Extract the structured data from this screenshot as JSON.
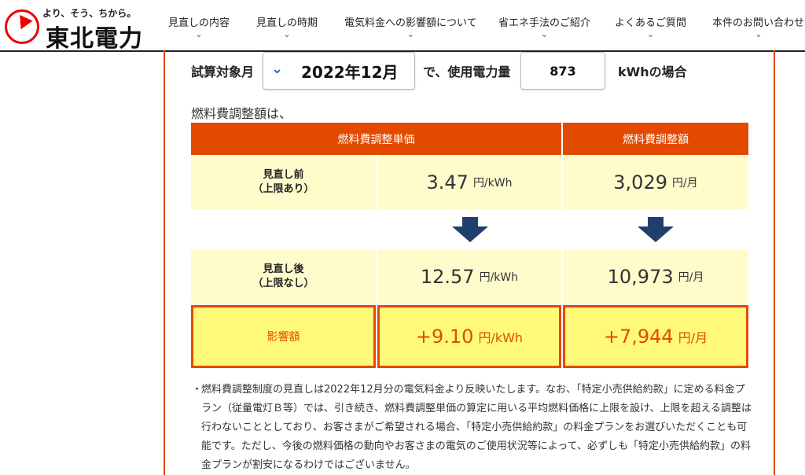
{
  "header": {
    "logo_tagline": "より、そう、ちから。",
    "logo_name": "東北電力",
    "nav": [
      {
        "label": "見直しの内容"
      },
      {
        "label": "見直しの時期"
      },
      {
        "label": "電気料金への影響額について"
      },
      {
        "label": "省エネ手法のご紹介"
      },
      {
        "label": "よくあるご質問"
      },
      {
        "label": "本件のお問い合わせ先"
      }
    ],
    "chevron": "⌄"
  },
  "calculator": {
    "label_month": "試算対象月",
    "month_value": "2022年12月",
    "label_usage": "で、使用電力量",
    "usage_value": "873",
    "label_unit": "kWhの場合"
  },
  "intro": "燃料費調整額は、",
  "table": {
    "head_unit_price": "燃料費調整単価",
    "head_amount": "燃料費調整額",
    "before": {
      "label_line1": "見直し前",
      "label_line2": "（上限あり）",
      "unit_price": "3.47",
      "unit_price_unit": "円/kWh",
      "amount": "3,029",
      "amount_unit": "円/月"
    },
    "after": {
      "label_line1": "見直し後",
      "label_line2": "（上限なし）",
      "unit_price": "12.57",
      "unit_price_unit": "円/kWh",
      "amount": "10,973",
      "amount_unit": "円/月"
    },
    "impact": {
      "label": "影響額",
      "unit_price": "+9.10",
      "unit_price_unit": "円/kWh",
      "amount": "+7,944",
      "amount_unit": "円/月"
    }
  },
  "notes": {
    "bullet": "・",
    "text": "燃料費調整制度の見直しは2022年12月分の電気料金より反映いたします。なお、「特定小売供給約款」に定める料金プラン（従量電灯Ｂ等）では、引き続き、燃料費調整単価の算定に用いる平均燃料価格に上限を設け、上限を超える調整は行わないこととしており、お客さまがご希望される場合、「特定小売供給約款」の料金プランをお選びいただくことも可能です。ただし、今後の燃料価格の動向やお客さまの電気のご使用状況等によって、必ずしも「特定小売供給約款」の料金プランが割安になるわけではございません。"
  },
  "colors": {
    "accent": "#e34a00",
    "row_bg": "#fffccc",
    "impact_bg": "#fff97a",
    "arrow": "#1f3f6e"
  }
}
